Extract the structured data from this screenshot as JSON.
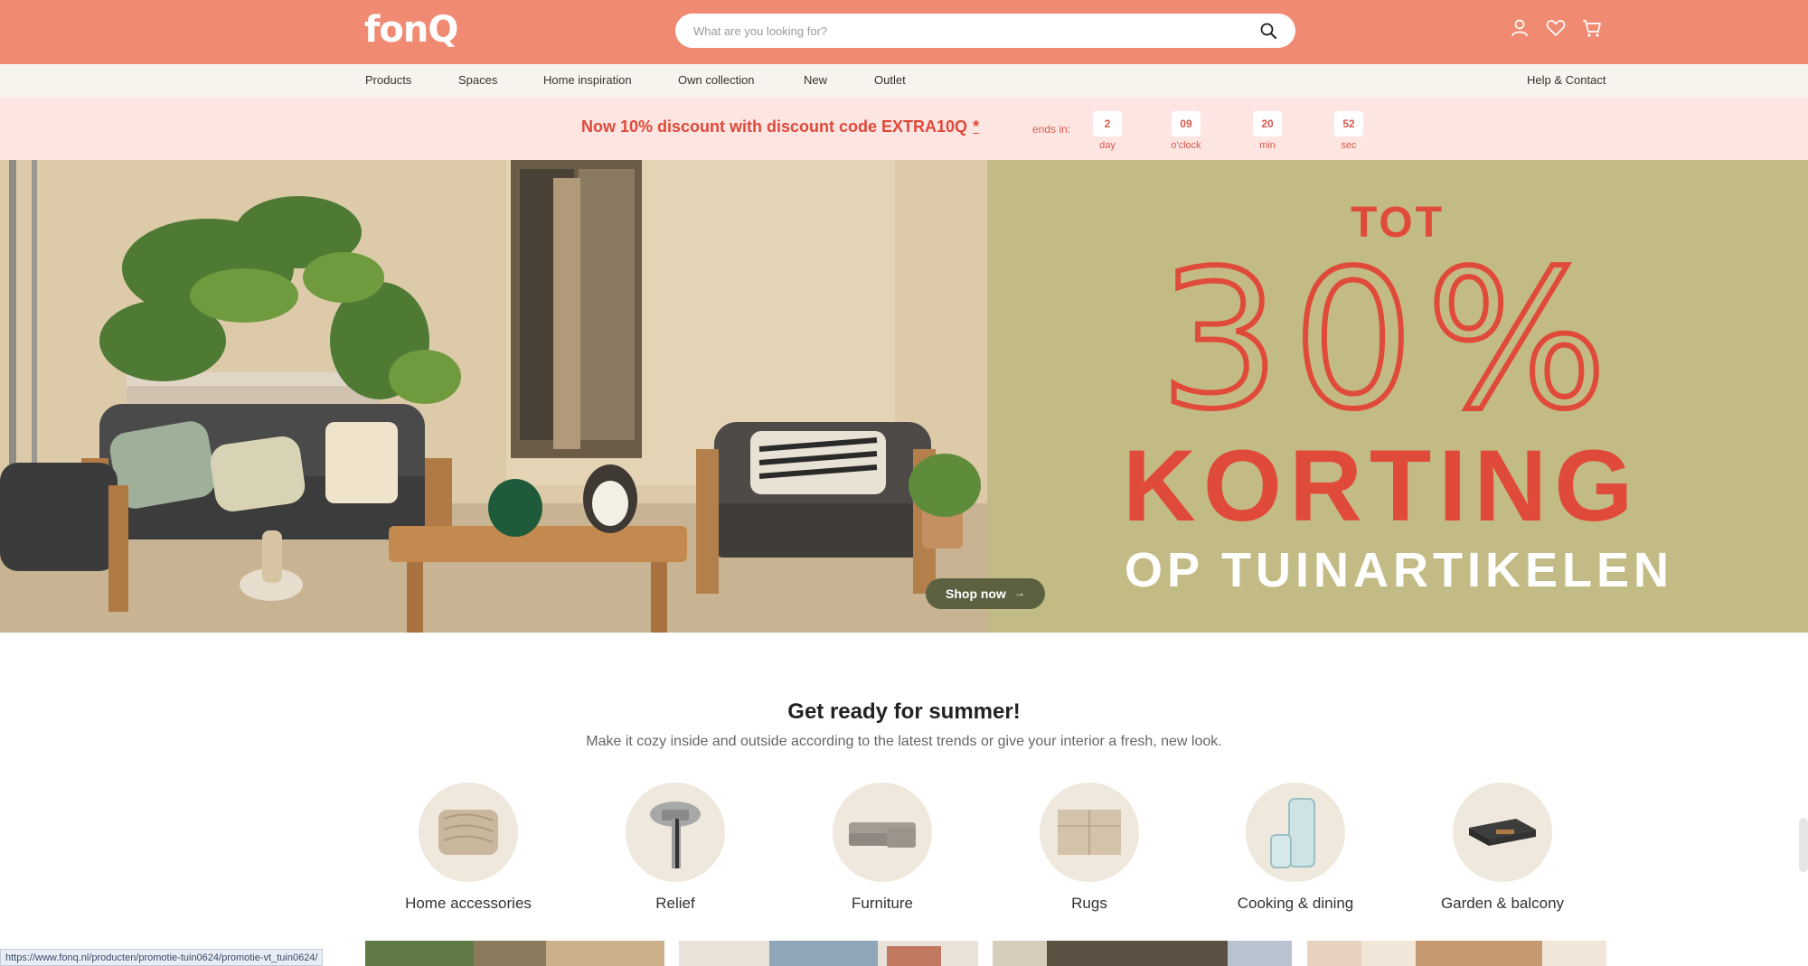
{
  "header": {
    "logo": "fonQ",
    "search_placeholder": "What are you looking for?",
    "icons": [
      "search-icon",
      "account-icon",
      "heart-icon",
      "cart-icon"
    ]
  },
  "nav": {
    "items": [
      "Products",
      "Spaces",
      "Home inspiration",
      "Own collection",
      "New",
      "Outlet"
    ],
    "help": "Help & Contact"
  },
  "promo": {
    "text": "Now 10% discount with discount code EXTRA10Q",
    "asterisk": "*",
    "ends_label": "ends in:",
    "countdown": [
      {
        "value": "2",
        "unit": "day"
      },
      {
        "value": "09",
        "unit": "o'clock"
      },
      {
        "value": "20",
        "unit": "min"
      },
      {
        "value": "52",
        "unit": "sec"
      }
    ]
  },
  "hero": {
    "line1": "TOT",
    "percent": "30%",
    "line3": "KORTING",
    "line4": "OP TUINARTIKELEN",
    "cta": "Shop now",
    "cta_arrow": "→"
  },
  "summer": {
    "title": "Get ready for summer!",
    "subtitle": "Make it cozy inside and outside according to the latest trends or give your interior a fresh, new look.",
    "categories": [
      {
        "label": "Home accessories",
        "icon": "pillow-icon"
      },
      {
        "label": "Relief",
        "icon": "lamp-icon"
      },
      {
        "label": "Furniture",
        "icon": "sofa-icon"
      },
      {
        "label": "Rugs",
        "icon": "rug-icon"
      },
      {
        "label": "Cooking & dining",
        "icon": "glasses-icon"
      },
      {
        "label": "Garden & balcony",
        "icon": "garden-lounge-icon"
      }
    ]
  },
  "status_url": "https://www.fonq.nl/producten/promotie-tuin0624/promotie-vt_tuin0624/",
  "colors": {
    "header_bg": "#f08a72",
    "promo_bg": "#fde6e2",
    "accent_red": "#e04a3a",
    "hero_olive": "#c3bb85",
    "cta_green": "#5b6141"
  }
}
